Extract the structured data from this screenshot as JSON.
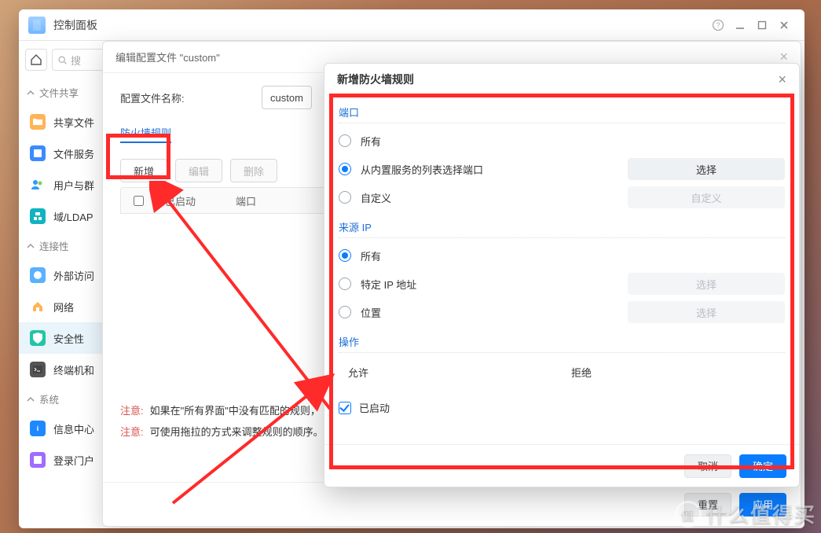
{
  "window": {
    "title": "控制面板"
  },
  "search": {
    "placeholder": "搜"
  },
  "sidebar": {
    "groups": [
      {
        "label": "文件共享",
        "items": [
          {
            "label": "共享文件",
            "icon": "folder"
          },
          {
            "label": "文件服务",
            "icon": "service"
          },
          {
            "label": "用户与群",
            "icon": "people"
          },
          {
            "label": "域/LDAP",
            "icon": "ldap"
          }
        ]
      },
      {
        "label": "连接性",
        "items": [
          {
            "label": "外部访问",
            "icon": "external"
          },
          {
            "label": "网络",
            "icon": "network"
          },
          {
            "label": "安全性",
            "icon": "security",
            "selected": true
          },
          {
            "label": "终端机和",
            "icon": "terminal"
          }
        ]
      },
      {
        "label": "系统",
        "items": [
          {
            "label": "信息中心",
            "icon": "info"
          },
          {
            "label": "登录门户",
            "icon": "portal"
          }
        ]
      }
    ]
  },
  "modal1": {
    "title": "编辑配置文件 \"custom\"",
    "profile_name_label": "配置文件名称:",
    "profile_name_value": "custom",
    "rules_section": "防火墙规则",
    "buttons": {
      "add": "新增",
      "edit": "编辑",
      "delete": "删除"
    },
    "grid": {
      "enabled_col": "已启动",
      "port_col": "端口"
    },
    "notes": {
      "prefix": "注意:",
      "line1": "如果在\"所有界面\"中没有匹配的规则，",
      "line2": "可使用拖拉的方式来调整规则的顺序。"
    },
    "footer": {
      "reset": "重置",
      "apply": "应用"
    }
  },
  "modal2": {
    "title": "新增防火墙规则",
    "sections": {
      "port": "端口",
      "source": "来源 IP",
      "action": "操作"
    },
    "port": {
      "all": "所有",
      "builtin": "从内置服务的列表选择端口",
      "custom": "自定义",
      "select_btn": "选择",
      "custom_btn": "自定义"
    },
    "source": {
      "all": "所有",
      "specific": "特定 IP 地址",
      "location": "位置",
      "select_btn": "选择"
    },
    "action": {
      "allow": "允许",
      "deny": "拒绝"
    },
    "enabled_label": "已启动",
    "footer": {
      "cancel": "取消",
      "ok": "确定"
    }
  },
  "watermark": {
    "badge": "值",
    "text": "什么值得买"
  }
}
